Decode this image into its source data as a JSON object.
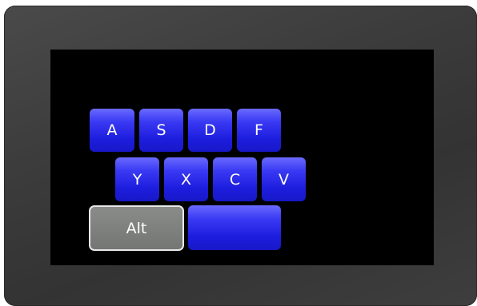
{
  "keyboard": {
    "row1": [
      "A",
      "S",
      "D",
      "F"
    ],
    "row2": [
      "Y",
      "X",
      "C",
      "V"
    ],
    "alt_label": "Alt",
    "space_label": ""
  },
  "colors": {
    "key_blue": "#2a2ae6",
    "key_alt_gray": "#7c7e7c",
    "screen_bg": "#000000",
    "bezel": "#3c3c3c"
  }
}
